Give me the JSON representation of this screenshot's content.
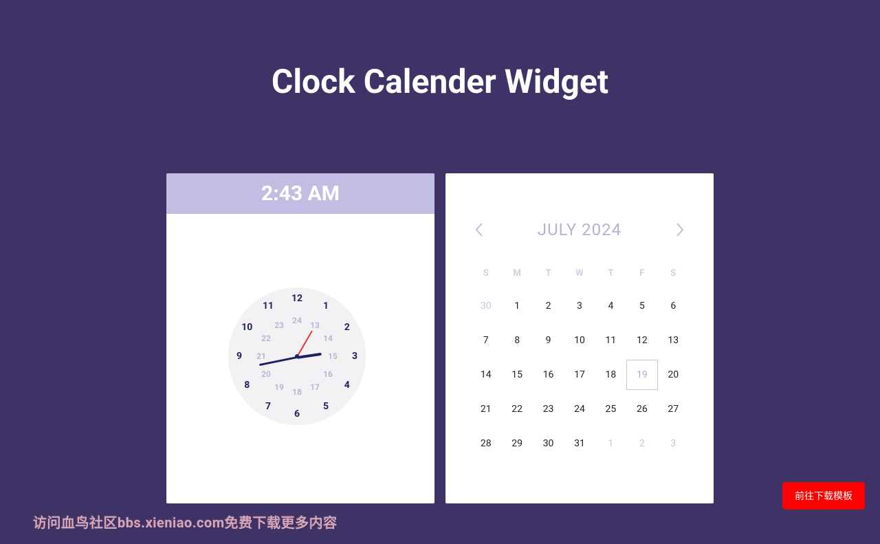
{
  "title": "Clock Calender Widget",
  "clock": {
    "time_label": "2:43 AM",
    "hours": 2,
    "minutes": 43,
    "seconds": 5,
    "outer_numerals": [
      "12",
      "1",
      "2",
      "3",
      "4",
      "5",
      "6",
      "7",
      "8",
      "9",
      "10",
      "11"
    ],
    "inner_numerals": [
      "24",
      "13",
      "14",
      "15",
      "16",
      "17",
      "18",
      "19",
      "20",
      "21",
      "22",
      "23"
    ]
  },
  "calendar": {
    "month_year": "JULY 2024",
    "dow": [
      "S",
      "M",
      "T",
      "W",
      "T",
      "F",
      "S"
    ],
    "today": 19,
    "weeks": [
      [
        {
          "n": 30,
          "other": true
        },
        {
          "n": 1
        },
        {
          "n": 2
        },
        {
          "n": 3
        },
        {
          "n": 4
        },
        {
          "n": 5
        },
        {
          "n": 6
        }
      ],
      [
        {
          "n": 7
        },
        {
          "n": 8
        },
        {
          "n": 9
        },
        {
          "n": 10
        },
        {
          "n": 11
        },
        {
          "n": 12
        },
        {
          "n": 13
        }
      ],
      [
        {
          "n": 14
        },
        {
          "n": 15
        },
        {
          "n": 16
        },
        {
          "n": 17
        },
        {
          "n": 18
        },
        {
          "n": 19,
          "today": true
        },
        {
          "n": 20
        }
      ],
      [
        {
          "n": 21
        },
        {
          "n": 22
        },
        {
          "n": 23
        },
        {
          "n": 24
        },
        {
          "n": 25
        },
        {
          "n": 26
        },
        {
          "n": 27
        }
      ],
      [
        {
          "n": 28
        },
        {
          "n": 29
        },
        {
          "n": 30
        },
        {
          "n": 31
        },
        {
          "n": 1,
          "other": true
        },
        {
          "n": 2,
          "other": true
        },
        {
          "n": 3,
          "other": true
        }
      ]
    ]
  },
  "download_button": "前往下载模板",
  "watermark": "访问血鸟社区bbs.xieniao.com免费下载更多内容"
}
